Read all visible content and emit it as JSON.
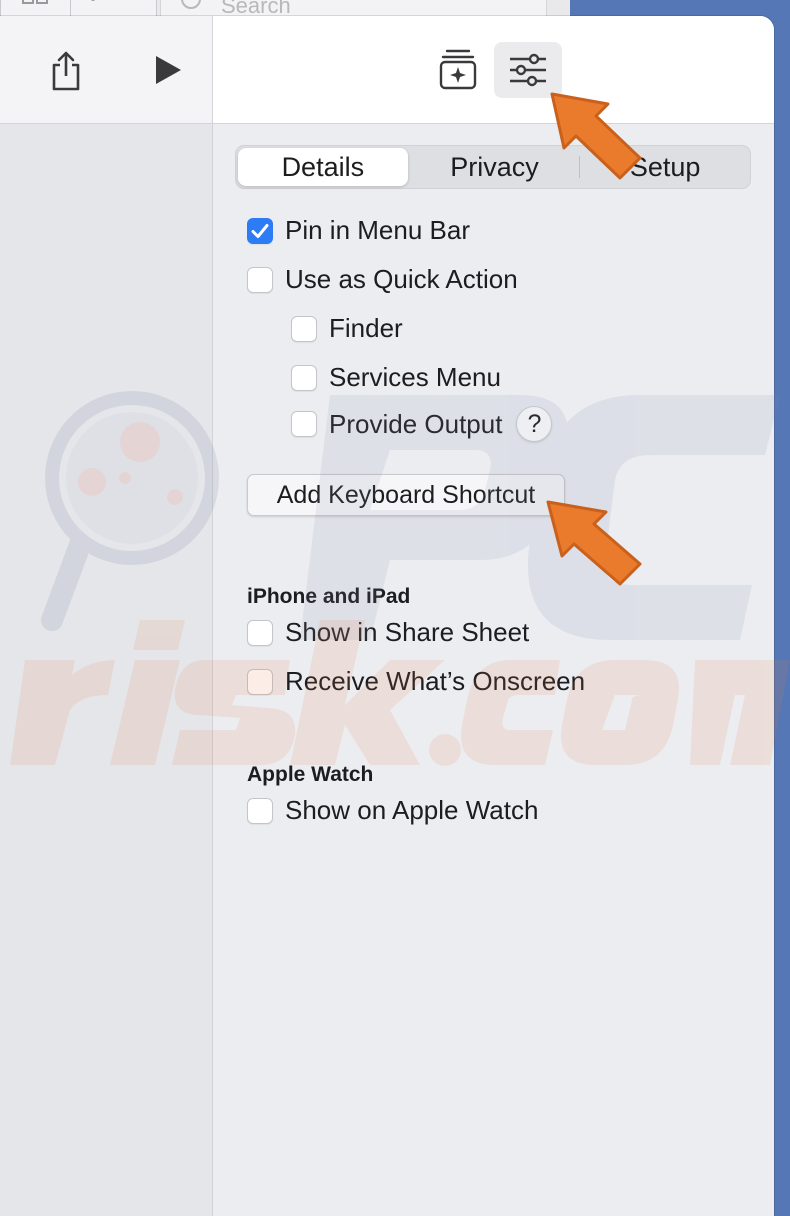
{
  "background_window": {
    "search_placeholder": "Search"
  },
  "toolbar": {
    "share_icon": "share-icon",
    "run_icon": "play-icon",
    "library_icon": "action-library-icon",
    "details_icon": "sliders-icon"
  },
  "tabs": [
    {
      "label": "Details",
      "selected": true
    },
    {
      "label": "Privacy",
      "selected": false
    },
    {
      "label": "Setup",
      "selected": false
    }
  ],
  "options": {
    "pin_in_menu_bar": {
      "label": "Pin in Menu Bar",
      "checked": true
    },
    "use_as_quick_action": {
      "label": "Use as Quick Action",
      "checked": false
    },
    "finder": {
      "label": "Finder",
      "checked": false
    },
    "services_menu": {
      "label": "Services Menu",
      "checked": false
    },
    "provide_output": {
      "label": "Provide Output",
      "checked": false
    },
    "help_symbol": "?"
  },
  "add_shortcut_label": "Add Keyboard Shortcut",
  "iphone_ipad": {
    "header": "iPhone and iPad",
    "show_in_share_sheet": {
      "label": "Show in Share Sheet",
      "checked": false
    },
    "receive_whats_onscreen": {
      "label": "Receive What’s Onscreen",
      "checked": false
    }
  },
  "apple_watch": {
    "header": "Apple Watch",
    "show_on_apple_watch": {
      "label": "Show on Apple Watch",
      "checked": false
    }
  },
  "watermark_text": "PCrisk.com",
  "colors": {
    "accent": "#2c7cf6",
    "annotation_arrow": "#ea7a2c",
    "window_bg": "#ecedf1",
    "desktop": "#5677b6"
  }
}
